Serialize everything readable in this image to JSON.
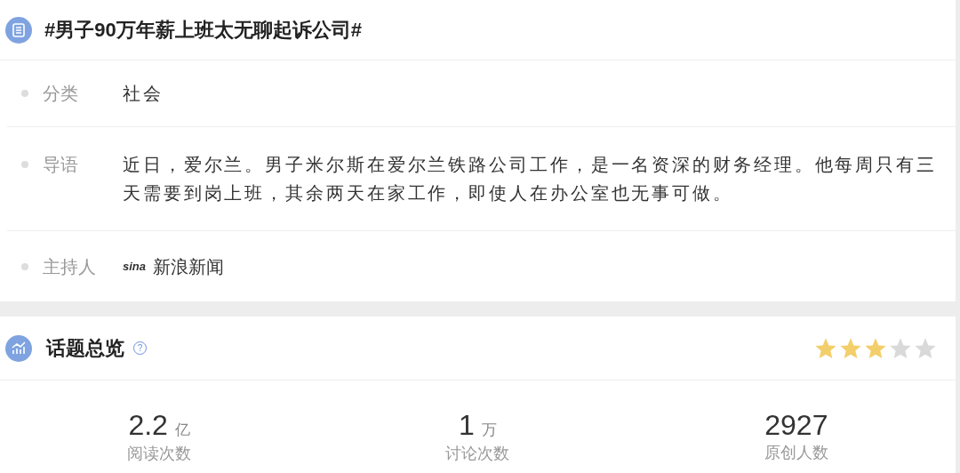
{
  "topic": {
    "title": "#男子90万年薪上班太无聊起诉公司#"
  },
  "details": [
    {
      "kind": "text",
      "label": "分类",
      "value": "社会"
    },
    {
      "kind": "text",
      "label": "导语",
      "value": "近日，爱尔兰。男子米尔斯在爱尔兰铁路公司工作，是一名资深的财务经理。他每周只有三天需要到岗上班，其余两天在家工作，即使人在办公室也无事可做。"
    },
    {
      "kind": "host",
      "label": "主持人",
      "logo": "sina",
      "value": "新浪新闻"
    }
  ],
  "overview": {
    "title": "话题总览",
    "help": "?",
    "stars": 3,
    "stats": [
      {
        "value": "2.2",
        "unit": "亿",
        "label": "阅读次数"
      },
      {
        "value": "1",
        "unit": "万",
        "label": "讨论次数"
      },
      {
        "value": "2927",
        "label": "原创人数"
      }
    ]
  }
}
